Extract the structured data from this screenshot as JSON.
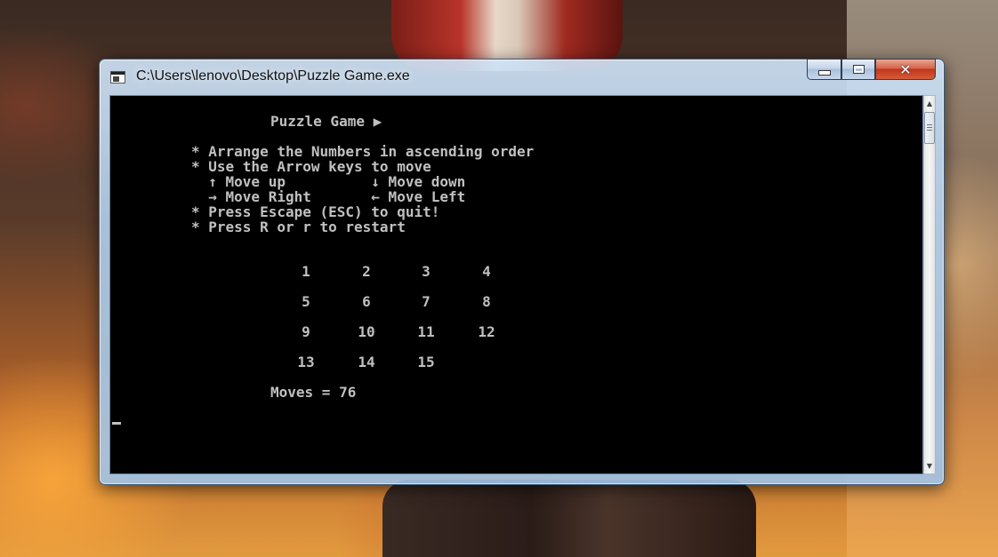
{
  "window": {
    "title": "C:\\Users\\lenovo\\Desktop\\Puzzle Game.exe",
    "close_label": "✕"
  },
  "console": {
    "heading": "Puzzle Game ▶",
    "instructions": [
      "* Arrange the Numbers in ascending order",
      "* Use the Arrow keys to move",
      "  ↑ Move up          ↓ Move down",
      "  → Move Right       ← Move Left",
      "* Press Escape (ESC) to quit!",
      "* Press R or r to restart"
    ],
    "board": [
      [
        "1",
        "2",
        "3",
        "4"
      ],
      [
        "5",
        "6",
        "7",
        "8"
      ],
      [
        "9",
        "10",
        "11",
        "12"
      ],
      [
        "13",
        "14",
        "15",
        ""
      ]
    ],
    "moves_text": "Moves = 76"
  },
  "icons": {
    "app": "console-app-icon",
    "minimize": "minimize-icon",
    "maximize": "maximize-icon",
    "close": "close-icon",
    "scroll_up": "scroll-up-arrow-icon",
    "scroll_down": "scroll-down-arrow-icon"
  },
  "colors": {
    "console_bg": "#000000",
    "console_text": "#c0c0c0",
    "close_button": "#c1371b"
  }
}
